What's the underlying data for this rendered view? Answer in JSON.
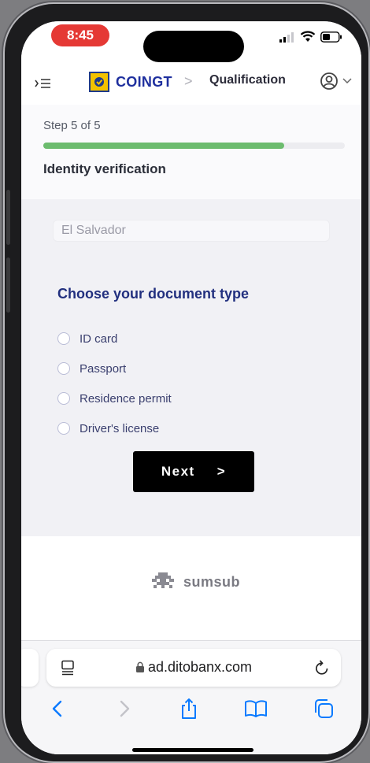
{
  "status_bar": {
    "time": "8:45"
  },
  "header": {
    "brand": "COINGT",
    "breadcrumb_sep": ">",
    "page": "Qualification"
  },
  "stepper": {
    "step_text": "Step 5 of 5",
    "progress": 0.8,
    "title": "Identity verification"
  },
  "form": {
    "country": "El Salvador",
    "heading": "Choose your document type",
    "options": [
      "ID card",
      "Passport",
      "Residence permit",
      "Driver's license"
    ],
    "next_label": "Next",
    "next_arrow": ">"
  },
  "footer": {
    "powered_by": "sumsub"
  },
  "browser": {
    "url": "ad.ditobanx.com"
  },
  "colors": {
    "brand": "#1e2f9e",
    "progress": "#6cbc6e",
    "heading": "#22307f",
    "time_pill": "#e53935",
    "ios_blue": "#0a7aff"
  }
}
